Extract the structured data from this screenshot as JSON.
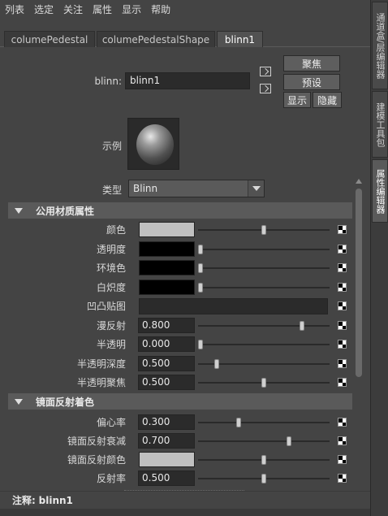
{
  "menu": [
    "列表",
    "选定",
    "关注",
    "属性",
    "显示",
    "帮助"
  ],
  "side_tabs": [
    "通道盒/层编辑器",
    "建模工具包",
    "属性编辑器"
  ],
  "tabs": [
    "columePedestal",
    "columePedestalShape",
    "blinn1"
  ],
  "header": {
    "name_label": "blinn:",
    "name_value": "blinn1",
    "focus_btn": "聚焦",
    "preset_btn": "预设",
    "show_btn": "显示",
    "hide_btn": "隐藏",
    "sample_label": "示例",
    "type_label": "类型",
    "type_value": "Blinn"
  },
  "sections": {
    "common": {
      "title": "公用材质属性",
      "rows": [
        {
          "label": "颜色",
          "color": "#c0c0c0",
          "slider": 0.5
        },
        {
          "label": "透明度",
          "color": "#000000",
          "slider": 0.0
        },
        {
          "label": "环境色",
          "color": "#000000",
          "slider": 0.0
        },
        {
          "label": "白炽度",
          "color": "#000000",
          "slider": 0.0
        },
        {
          "label": "凹凸贴图"
        },
        {
          "label": "漫反射",
          "value": "0.800",
          "slider": 0.8
        },
        {
          "label": "半透明",
          "value": "0.000",
          "slider": 0.0
        },
        {
          "label": "半透明深度",
          "value": "0.500",
          "slider": 0.125
        },
        {
          "label": "半透明聚焦",
          "value": "0.500",
          "slider": 0.5
        }
      ]
    },
    "specular": {
      "title": "镜面反射着色",
      "rows": [
        {
          "label": "偏心率",
          "value": "0.300",
          "slider": 0.3
        },
        {
          "label": "镜面反射衰减",
          "value": "0.700",
          "slider": 0.7
        },
        {
          "label": "镜面反射颜色",
          "color": "#c0c0c0",
          "slider": 0.5
        },
        {
          "label": "反射率",
          "value": "0.500",
          "slider": 0.5
        }
      ]
    }
  },
  "notes": {
    "label": "注释:",
    "value": "blinn1"
  }
}
